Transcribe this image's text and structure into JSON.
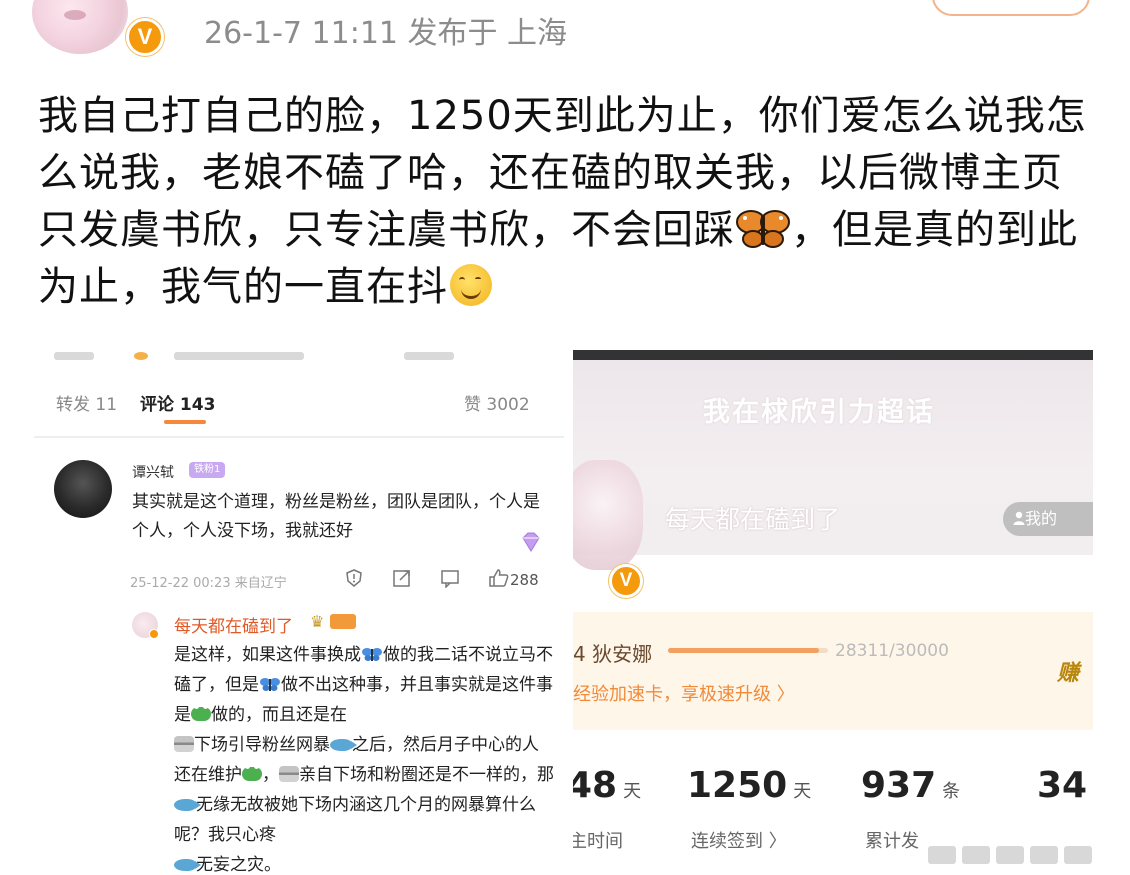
{
  "header": {
    "meta": "26-1-7 11:11  发布于 上海",
    "verified_mark": "V"
  },
  "post": {
    "text_before_butterfly": "我自己打自己的脸，1250天到此为止，你们爱怎么说我怎么说我，老娘不磕了哈，还在磕的取关我，以后微博主页只发虞书欣，只专注虞书欣，不会回踩",
    "text_after_butterfly": "，但是真的到此为止，我气的一直在抖",
    "emojis": [
      "butterfly-icon",
      "smile-icon"
    ]
  },
  "left_screenshot": {
    "tabs": [
      {
        "label": "转发 11"
      },
      {
        "label": "评论 143",
        "active": true
      },
      {
        "label": "赞 3002"
      }
    ],
    "comment": {
      "user": "谭兴轼",
      "badge": "铁粉1",
      "text": "其实就是这个道理，粉丝是粉丝，团队是团队，个人是个人，个人没下场，我就还好",
      "meta": "25-12-22 00:23 来自辽宁",
      "likes": "288"
    },
    "reply": {
      "user": "每天都在磕到了",
      "segments": [
        "是这样，如果这件事换成",
        "做的我二话不说立马不磕了，但是",
        "做不出这种事，并且事实就是这件事是",
        "做的，而且还是在",
        "下场引导粉丝网暴",
        "之后，然后月子中心的人还在维护",
        "，",
        "亲自下场和粉圈还是不一样的，那",
        "无缘无故被她下场内涵这几个月的网暴算什么呢？我只心疼",
        "无妄之灾。"
      ]
    }
  },
  "right_screenshot": {
    "super_topic_title": "我在梂欣引力超话",
    "profile_name": "每天都在磕到了",
    "my_button": "我的",
    "level_name": "4 狄安娜",
    "progress_text": "28311/30000",
    "progress": {
      "current": 28311,
      "max": 30000
    },
    "earn": "赚",
    "speed_text": "经验加速卡，享极速升级 〉",
    "stats": [
      {
        "num": "48",
        "unit": "天",
        "label": "主时间"
      },
      {
        "num": "1250",
        "unit": "天",
        "label": "连续签到 〉"
      },
      {
        "num": "937",
        "unit": "条",
        "label": "累计发"
      },
      {
        "num": "34",
        "unit": "",
        "label": ""
      }
    ]
  },
  "colors": {
    "accent_orange": "#f7883a",
    "verified_badge": "#f59a0c",
    "reply_name": "#e05a28"
  }
}
